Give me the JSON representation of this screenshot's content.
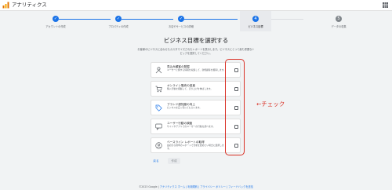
{
  "header": {
    "app_title": "アナリティクス"
  },
  "steps": [
    {
      "label": "アカウントの作成",
      "state": "done"
    },
    {
      "label": "プロパティの作成",
      "state": "done"
    },
    {
      "label": "お店やサービスの詳細",
      "state": "done"
    },
    {
      "label": "ビジネス目標",
      "state": "current",
      "number": "4"
    },
    {
      "label": "データの収集",
      "state": "pending",
      "number": "5"
    }
  ],
  "main": {
    "heading": "ビジネス目標を選択する",
    "description": "お客様のビジネスに合わせたカスタマイズされたレポートを表示します。ビジネスにとって最も重要なトピックを選択してください。"
  },
  "options": [
    {
      "title": "見込み顧客の発掘",
      "subtitle": "ユーザーに関する情報を収集して、新規顧客を獲得します。",
      "icon": "leads-icon"
    },
    {
      "title": "オンライン販売の促進",
      "subtitle": "購入行動を把握して、売り上げを伸ばします。",
      "icon": "cart-icon"
    },
    {
      "title": "ブランド認知度の向上",
      "subtitle": "ビジネスを広く知ってもらいます。",
      "icon": "tag-icon"
    },
    {
      "title": "ユーザー行動の調査",
      "subtitle": "サイトやアプリでのユーザーの行動を調べます。",
      "icon": "chat-icon"
    },
    {
      "title": "ベースライン レポートの取得",
      "subtitle": "最初から標準のレポートで分析を始めたい場合に選択します。",
      "icon": "person-icon"
    }
  ],
  "annotation": {
    "text": "←チェック",
    "color": "#d93025"
  },
  "buttons": {
    "back": "戻る",
    "create": "作成"
  },
  "footer": {
    "copyright": "©2023 Google | ",
    "links": "アナリティクス ホーム | 利用規約 | プライバシー ポリシー | ",
    "feedback": "フィードバックを送信"
  },
  "colors": {
    "accent": "#1a73e8",
    "pending": "#80868b",
    "annotation": "#d93025"
  }
}
